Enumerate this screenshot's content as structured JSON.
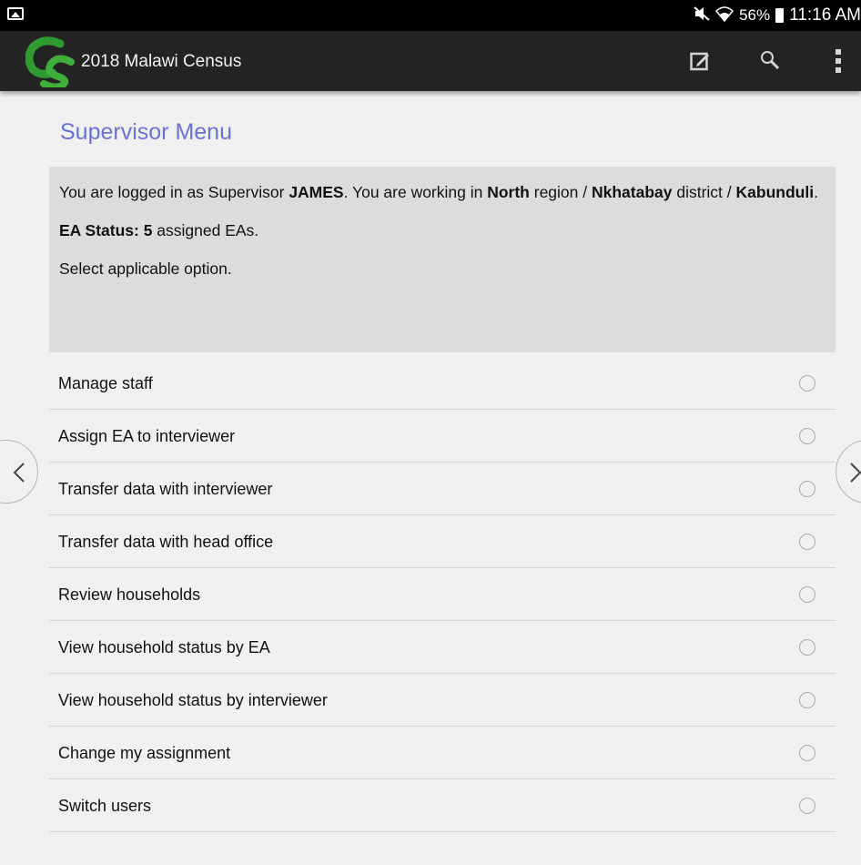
{
  "status_bar": {
    "icons": [
      "picture-icon",
      "mute-icon",
      "wifi-icon",
      "battery-icon"
    ],
    "battery": "56%",
    "time": "11:16 AM"
  },
  "app_bar": {
    "title": "2018 Malawi Census",
    "logo_text": "CS",
    "actions": [
      "edit-icon",
      "search-icon",
      "overflow-menu-icon"
    ]
  },
  "menu": {
    "title": "Supervisor Menu",
    "info": {
      "line1_prefix": "You are logged in as Supervisor ",
      "supervisor": "JAMES",
      "line1_mid": ". You are working in ",
      "region": "North",
      "line1_region_suffix": " region / ",
      "district": "Nkhatabay",
      "line1_district_suffix": " district / ",
      "area": "Kabunduli",
      "line1_end": ".",
      "ea_status_label": "EA Status: ",
      "ea_count": "5",
      "ea_suffix": " assigned EAs.",
      "instruction": "Select applicable option."
    },
    "options": [
      {
        "label": "Manage staff",
        "selected": false
      },
      {
        "label": "Assign EA to interviewer",
        "selected": false
      },
      {
        "label": "Transfer data with interviewer",
        "selected": false
      },
      {
        "label": "Transfer data with head office",
        "selected": false
      },
      {
        "label": "Review households",
        "selected": false
      },
      {
        "label": "View household status by EA",
        "selected": false
      },
      {
        "label": "View household status by interviewer",
        "selected": false
      },
      {
        "label": "Change my assignment",
        "selected": false
      },
      {
        "label": "Switch users",
        "selected": false
      }
    ]
  },
  "colors": {
    "title_accent": "#6b72d3",
    "app_bar": "#232323",
    "info_box": "#dcdcdc",
    "logo_green": "#2f9a2f"
  }
}
